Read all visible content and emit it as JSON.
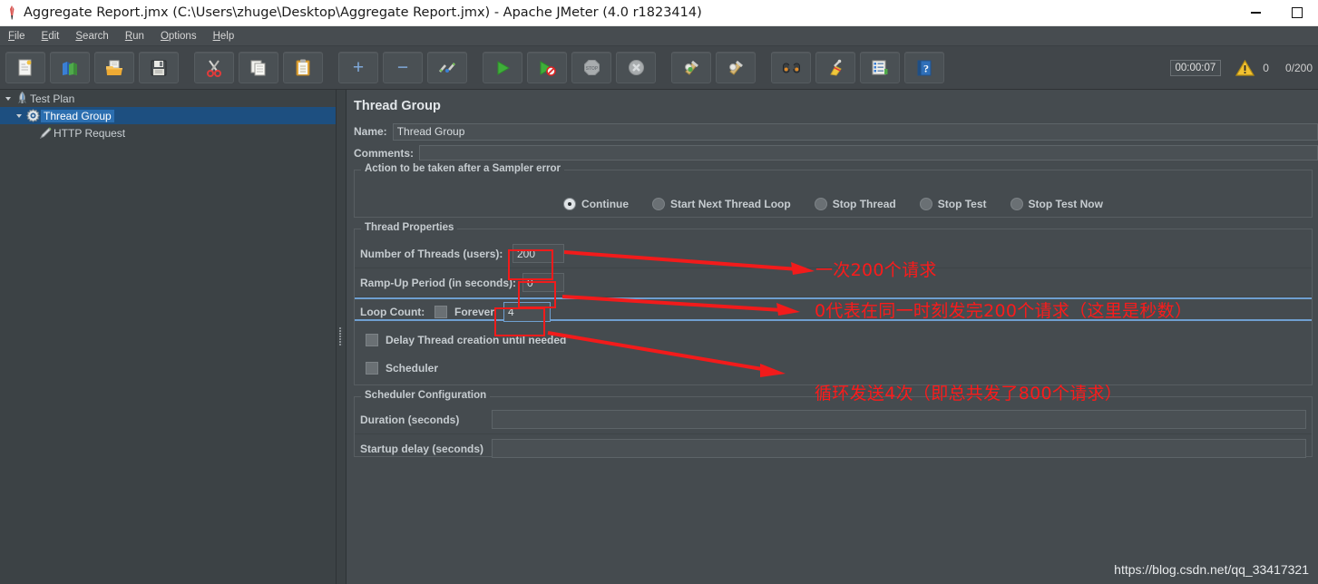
{
  "window": {
    "title": "Aggregate Report.jmx (C:\\Users\\zhuge\\Desktop\\Aggregate Report.jmx) - Apache JMeter (4.0 r1823414)",
    "app_icon": "jmeter-feather-icon",
    "minimize_label": "Minimize",
    "maximize_label": "Maximize"
  },
  "menubar": {
    "items": [
      {
        "label": "File",
        "mnemonic": "F"
      },
      {
        "label": "Edit",
        "mnemonic": "E"
      },
      {
        "label": "Search",
        "mnemonic": "S"
      },
      {
        "label": "Run",
        "mnemonic": "R"
      },
      {
        "label": "Options",
        "mnemonic": "O"
      },
      {
        "label": "Help",
        "mnemonic": "H"
      }
    ]
  },
  "toolbar": {
    "buttons": [
      {
        "name": "new-button",
        "icon": "new-document-icon",
        "tooltip": "New"
      },
      {
        "name": "templates-button",
        "icon": "templates-books-icon",
        "tooltip": "Templates"
      },
      {
        "name": "open-button",
        "icon": "open-folder-icon",
        "tooltip": "Open"
      },
      {
        "name": "save-button",
        "icon": "floppy-disk-icon",
        "tooltip": "Save Test Plan"
      },
      {
        "name": "cut-button",
        "icon": "scissors-icon",
        "tooltip": "Cut"
      },
      {
        "name": "copy-button",
        "icon": "copy-pages-icon",
        "tooltip": "Copy"
      },
      {
        "name": "paste-button",
        "icon": "clipboard-icon",
        "tooltip": "Paste"
      },
      {
        "name": "expand-all-button",
        "icon": "plus-icon",
        "tooltip": "Expand All",
        "symbol": "+"
      },
      {
        "name": "collapse-all-button",
        "icon": "minus-icon",
        "tooltip": "Collapse All",
        "symbol": "−"
      },
      {
        "name": "toggle-button",
        "icon": "toggle-switch-icon",
        "tooltip": "Toggle"
      },
      {
        "name": "start-button",
        "icon": "green-play-icon",
        "tooltip": "Start"
      },
      {
        "name": "start-no-pauses-button",
        "icon": "play-no-pause-icon",
        "tooltip": "Start no pauses"
      },
      {
        "name": "stop-button",
        "icon": "stop-sign-icon",
        "tooltip": "Stop"
      },
      {
        "name": "shutdown-button",
        "icon": "shutdown-circle-icon",
        "tooltip": "Shutdown"
      },
      {
        "name": "clear-button",
        "icon": "clear-broom-green-icon",
        "tooltip": "Clear"
      },
      {
        "name": "clear-all-button",
        "icon": "clear-all-broom-icon",
        "tooltip": "Clear All"
      },
      {
        "name": "search-button",
        "icon": "binoculars-icon",
        "tooltip": "Search"
      },
      {
        "name": "reset-search-button",
        "icon": "yellow-broom-icon",
        "tooltip": "Reset Search"
      },
      {
        "name": "function-helper-button",
        "icon": "function-helper-list-icon",
        "tooltip": "Function Helper Dialog"
      },
      {
        "name": "help-button",
        "icon": "help-book-icon",
        "tooltip": "Help"
      }
    ],
    "timer": "00:00:07",
    "warning_icon": "warning-triangle-icon",
    "warning_count": "0",
    "run_count": "0/200"
  },
  "tree": {
    "nodes": [
      {
        "label": "Test Plan",
        "icon": "test-plan-icon",
        "expanded": true,
        "selected": false,
        "indent": 0
      },
      {
        "label": "Thread Group",
        "icon": "thread-group-gear-icon",
        "expanded": true,
        "selected": true,
        "indent": 1
      },
      {
        "label": "HTTP Request",
        "icon": "http-request-pencil-icon",
        "expanded": false,
        "selected": false,
        "indent": 2
      }
    ]
  },
  "main": {
    "title": "Thread Group",
    "name_label": "Name:",
    "name_value": "Thread Group",
    "comments_label": "Comments:",
    "comments_value": "",
    "sampler_error": {
      "legend": "Action to be taken after a Sampler error",
      "options": [
        {
          "label": "Continue",
          "selected": true
        },
        {
          "label": "Start Next Thread Loop",
          "selected": false
        },
        {
          "label": "Stop Thread",
          "selected": false
        },
        {
          "label": "Stop Test",
          "selected": false
        },
        {
          "label": "Stop Test Now",
          "selected": false
        }
      ]
    },
    "thread_properties": {
      "legend": "Thread Properties",
      "num_threads_label": "Number of Threads (users):",
      "num_threads_value": "200",
      "ramp_up_label": "Ramp-Up Period (in seconds):",
      "ramp_up_value": "0",
      "loop_count_label": "Loop Count:",
      "forever_label": "Forever",
      "forever_checked": false,
      "loop_count_value": "4",
      "delay_thread_label": "Delay Thread creation until needed",
      "delay_thread_checked": false,
      "scheduler_label": "Scheduler",
      "scheduler_checked": false
    },
    "scheduler_config": {
      "legend": "Scheduler Configuration",
      "duration_label": "Duration (seconds)",
      "duration_value": "",
      "startup_delay_label": "Startup delay (seconds)",
      "startup_delay_value": ""
    }
  },
  "annotations": [
    {
      "text": "一次200个请求",
      "name": "annotation-threads"
    },
    {
      "text": "0代表在同一时刻发完200个请求（这里是秒数）",
      "name": "annotation-rampup"
    },
    {
      "text": "循环发送4次（即总共发了800个请求）",
      "name": "annotation-loopcount"
    }
  ],
  "watermark": "https://blog.csdn.net/qq_33417321",
  "colors": {
    "annotation_red": "#fb1b1b",
    "selection_blue": "#2c6fb0",
    "panel_bg": "#454b4f",
    "toolbar_bg": "#41464a"
  }
}
